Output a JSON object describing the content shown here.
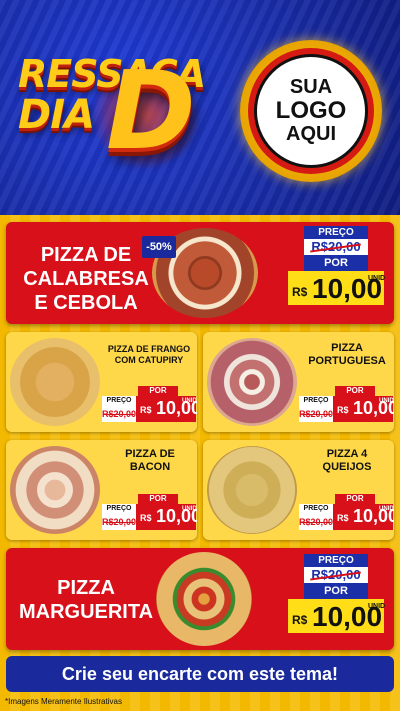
{
  "header": {
    "title_line1": "RESSACA",
    "title_line2": "DIA",
    "title_big": "D",
    "logo": {
      "line1": "SUA",
      "line2": "LOGO",
      "line3": "AQUI"
    }
  },
  "products": {
    "calabresa": {
      "name": "PIZZA DE CALABRESA E CEBOLA",
      "discount": "-50%",
      "preco_label": "PREÇO",
      "old_price": "R$20,00",
      "por_label": "POR",
      "currency": "R$",
      "new_price": "10,00",
      "unit": "UNID"
    },
    "frango": {
      "name": "PIZZA DE FRANGO COM CATUPIRY",
      "preco_label": "PREÇO",
      "old_price": "R$20,00",
      "por_label": "POR",
      "currency": "R$",
      "new_price": "10,00",
      "unit": "UNID"
    },
    "portuguesa": {
      "name": "PIZZA PORTUGUESA",
      "preco_label": "PREÇO",
      "old_price": "R$20,00",
      "por_label": "POR",
      "currency": "R$",
      "new_price": "10,00",
      "unit": "UNID"
    },
    "bacon": {
      "name": "PIZZA DE BACON",
      "preco_label": "PREÇO",
      "old_price": "R$20,00",
      "por_label": "POR",
      "currency": "R$",
      "new_price": "10,00",
      "unit": "UNID"
    },
    "quatro_queijos": {
      "name": "PIZZA 4 QUEIJOS",
      "preco_label": "PREÇO",
      "old_price": "R$20,00",
      "por_label": "POR",
      "currency": "R$",
      "new_price": "10,00",
      "unit": "UNID"
    },
    "marguerita": {
      "name": "PIZZA MARGUERITA",
      "preco_label": "PREÇO",
      "old_price": "R$20,00",
      "por_label": "POR",
      "currency": "R$",
      "new_price": "10,00",
      "unit": "UNID"
    }
  },
  "cta": {
    "label": "Crie seu encarte com este tema!"
  },
  "footnote": "*Imagens Meramente Ilustrativas",
  "colors": {
    "red": "#d7101a",
    "blue": "#1a2fa8",
    "yellow": "#ffde17",
    "gold": "#f2b400"
  }
}
